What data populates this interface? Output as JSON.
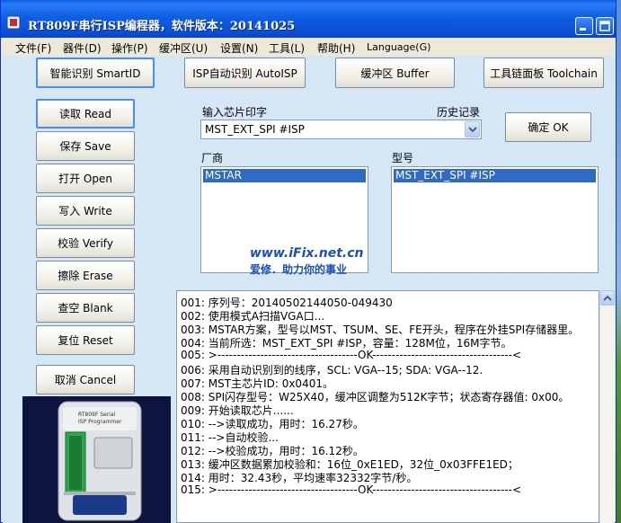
{
  "window": {
    "title": "RT809F串行ISP编程器，软件版本：20141025"
  },
  "menu": [
    {
      "id": "file",
      "label": "文件(F)"
    },
    {
      "id": "device",
      "label": "器件(D)"
    },
    {
      "id": "operate",
      "label": "操作(P)"
    },
    {
      "id": "buffer",
      "label": "缓冲区(U)"
    },
    {
      "id": "settings",
      "label": "设置(N)"
    },
    {
      "id": "tools",
      "label": "工具(L)"
    },
    {
      "id": "help",
      "label": "帮助(H)"
    },
    {
      "id": "language",
      "label": "Language(G)"
    }
  ],
  "top_buttons": {
    "smartid": "智能识别 SmartID",
    "autoisp": "ISP自动识别 AutoISP",
    "buffer": "缓冲区 Buffer",
    "toolchain": "工具链面板 Toolchain"
  },
  "side_buttons": {
    "read": "读取 Read",
    "save": "保存 Save",
    "open": "打开 Open",
    "write": "写入 Write",
    "verify": "校验 Verify",
    "erase": "擦除 Erase",
    "blank": "查空 Blank",
    "reset": "复位 Reset",
    "cancel": "取消 Cancel"
  },
  "chip_input": {
    "label": "输入芯片印字",
    "history_label": "历史记录",
    "value": "MST_EXT_SPI #ISP",
    "ok_button": "确定 OK"
  },
  "manufacturer": {
    "label": "厂商",
    "selected": "MSTAR"
  },
  "model": {
    "label": "型号",
    "selected": "MST_EXT_SPI #ISP"
  },
  "watermark": {
    "url": "www.iFix.net.cn",
    "slogan": "爱修．助力你的事业"
  },
  "log": [
    "001: 序列号：20140502144050-049430",
    "002: 使用模式A扫描VGA口...",
    "003: MSTAR方案，型号以MST、TSUM、SE、FE开头，程序在外挂SPI存储器里。",
    "004: 当前所选：MST_EXT_SPI #ISP，容量：128M位，16M字节。",
    "005: >------------------------------------OK------------------------------------<",
    "006: 采用自动识别到的线序，SCL: VGA--15; SDA: VGA--12.",
    "007: MST主芯片ID: 0x0401。",
    "008: SPI闪存型号：W25X40，缓冲区调整为512K字节；状态寄存器值: 0x00。",
    "009: 开始读取芯片......",
    "010: -->读取成功，用时：16.27秒。",
    "011: -->自动校验...",
    "012: -->校验成功，用时：16.12秒。",
    "013: 缓冲区数据累加校验和：16位_0xE1ED，32位_0x03FFE1ED；",
    "014: 用时：32.43秒，平均速率32332字节/秒。",
    "015: >------------------------------------OK------------------------------------<"
  ],
  "device_photo": {
    "label_line1": "RT809F Serial",
    "label_line2": "ISP Programmer"
  },
  "colors": {
    "titlebar": "#0a54e0",
    "client_bg": "#d5e6f5",
    "selection": "#316ac5",
    "watermark": "#1a4fb8"
  }
}
